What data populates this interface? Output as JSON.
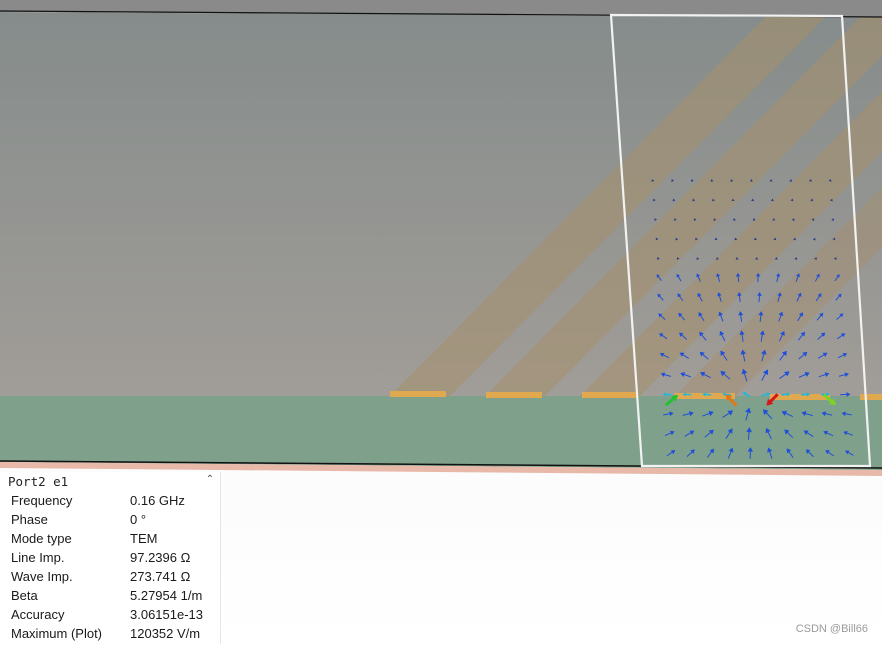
{
  "panel": {
    "title": "Port2 e1",
    "rows": [
      {
        "label": "Frequency",
        "value": "0.16 GHz"
      },
      {
        "label": "Phase",
        "value": "0 °"
      },
      {
        "label": "Mode type",
        "value": "TEM"
      },
      {
        "label": "Line Imp.",
        "value": "97.2396 Ω"
      },
      {
        "label": "Wave Imp.",
        "value": "273.741 Ω"
      },
      {
        "label": "Beta",
        "value": "5.27954 1/m"
      },
      {
        "label": "Accuracy",
        "value": "3.06151e-13"
      },
      {
        "label": "Maximum (Plot)",
        "value": "120352 V/m"
      }
    ]
  },
  "watermark": "CSDN @Bill66",
  "colors": {
    "air": "#8f8f8f",
    "substrate": "#7fa18b",
    "stripe": "#a68f6c",
    "trace": "#e0a94f",
    "ground": "#e8b8a8"
  },
  "icons": {
    "collapse": "chevron-up-icon"
  }
}
